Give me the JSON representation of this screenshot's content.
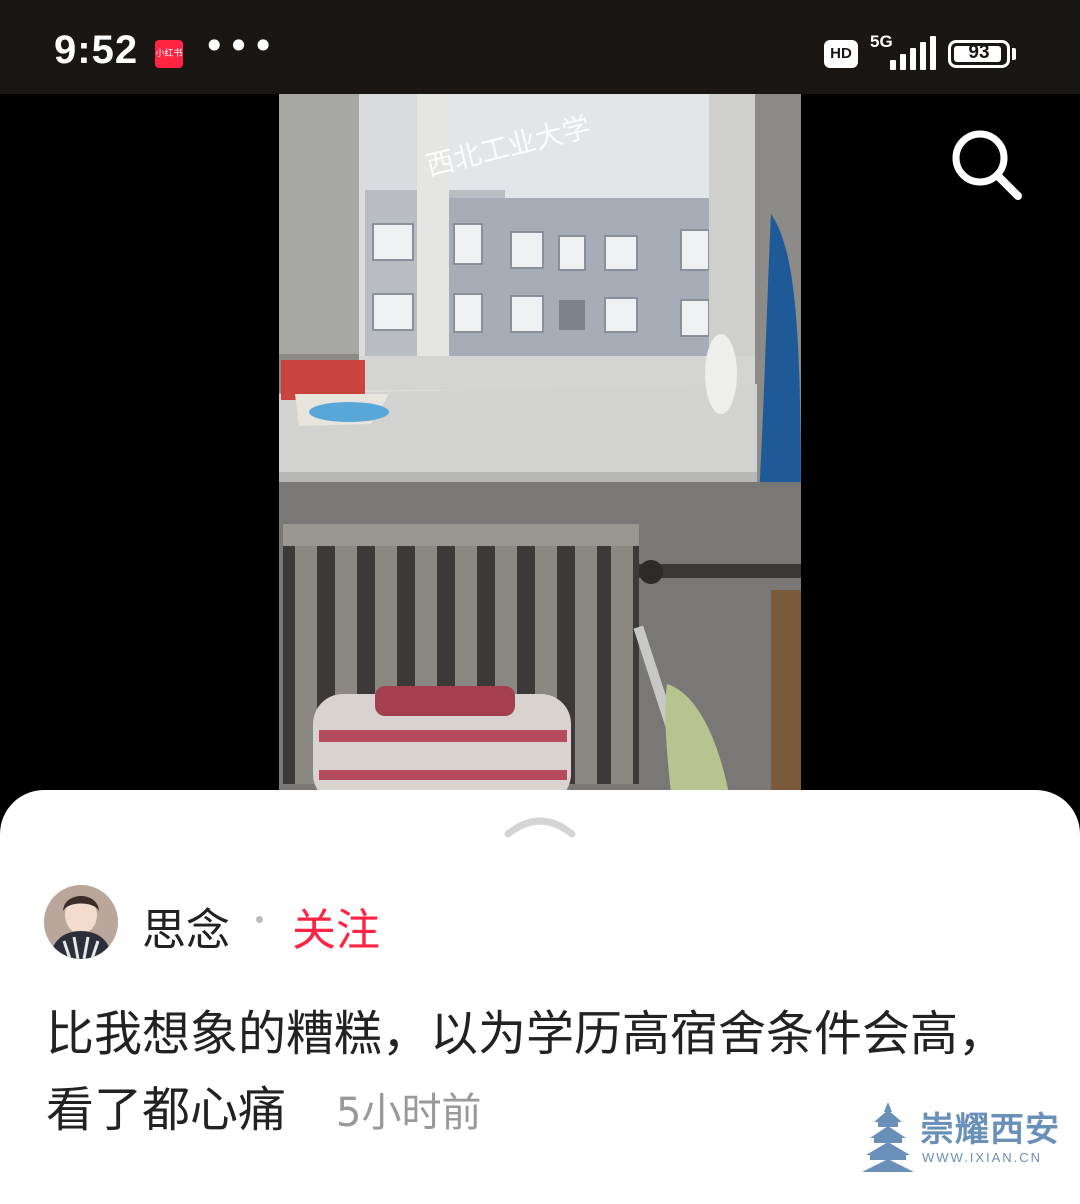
{
  "status_bar": {
    "time": "9:52",
    "app_badge": "小红书",
    "more": "•••",
    "hd": "HD",
    "network": "5G",
    "battery": "93",
    "battery_level": 0.93
  },
  "photo": {
    "watermark_text": "西北工业大学"
  },
  "post": {
    "author_name": "思念",
    "follow_label": "关注",
    "content": "比我想象的糟糕，以为学历高宿舍条件会高，看了都心痛",
    "time_ago": "5小时前"
  },
  "site_watermark": {
    "title": "崇耀西安",
    "url": "WWW.IXIAN.CN"
  },
  "colors": {
    "accent": "#ff2442",
    "status_bar_bg": "#1a1613"
  }
}
